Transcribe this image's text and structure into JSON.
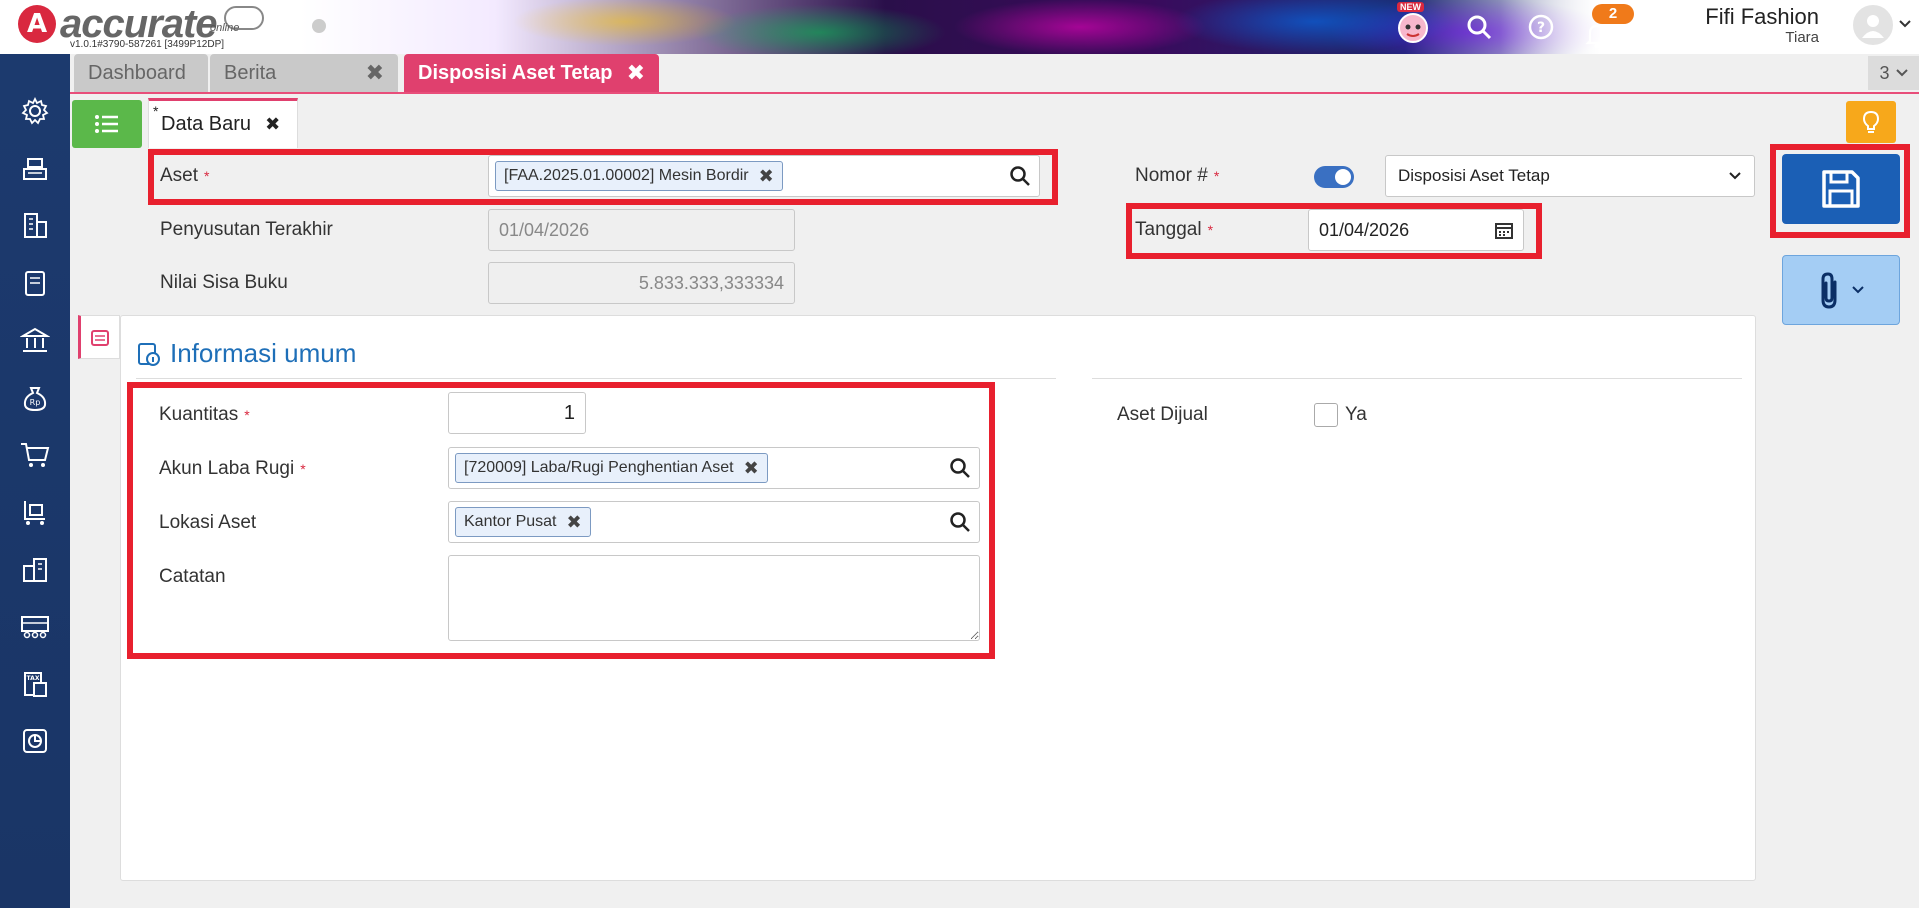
{
  "header": {
    "logo_text": "accurate",
    "logo_sub": "online",
    "version": "v1.0.1#3790-587261 [3499P12DP]",
    "new_badge": "NEW",
    "notif_count": "2",
    "user_name": "Fifi Fashion",
    "user_sub": "Tiara"
  },
  "sidebar": {
    "items": [
      "gear-icon",
      "cash-register-icon",
      "building-icon",
      "book-icon",
      "bank-icon",
      "money-bag-icon",
      "cart-icon",
      "trolley-icon",
      "warehouse-icon",
      "factory-icon",
      "tax-icon",
      "report-icon"
    ]
  },
  "tabs": {
    "dashboard": "Dashboard",
    "berita": "Berita",
    "active": "Disposisi Aset Tetap",
    "close": "✖",
    "count": "3"
  },
  "subtab": {
    "star": "*",
    "label": "Data Baru",
    "close": "✖"
  },
  "form": {
    "aset_label": "Aset",
    "aset_chip": "[FAA.2025.01.00002] Mesin Bordir",
    "penyusutan_label": "Penyusutan Terakhir",
    "penyusutan_value": "01/04/2026",
    "nilai_label": "Nilai Sisa Buku",
    "nilai_value": "5.833.333,333334",
    "nomor_label": "Nomor #",
    "nomor_select": "Disposisi Aset Tetap",
    "tanggal_label": "Tanggal",
    "tanggal_value": "01/04/2026",
    "required_mark": "*"
  },
  "info": {
    "title": "Informasi umum",
    "kuantitas_label": "Kuantitas",
    "kuantitas_value": "1",
    "akun_label": "Akun Laba Rugi",
    "akun_chip": "[720009] Laba/Rugi Penghentian Aset",
    "lokasi_label": "Lokasi Aset",
    "lokasi_chip": "Kantor Pusat",
    "catatan_label": "Catatan",
    "catatan_value": "",
    "aset_dijual_label": "Aset Dijual",
    "ya_label": "Ya"
  },
  "colors": {
    "accent_pink": "#e0406e",
    "save_blue": "#1b5fb5",
    "annotation_red": "#e8202e",
    "sidebar_navy": "#1c3a6e"
  }
}
